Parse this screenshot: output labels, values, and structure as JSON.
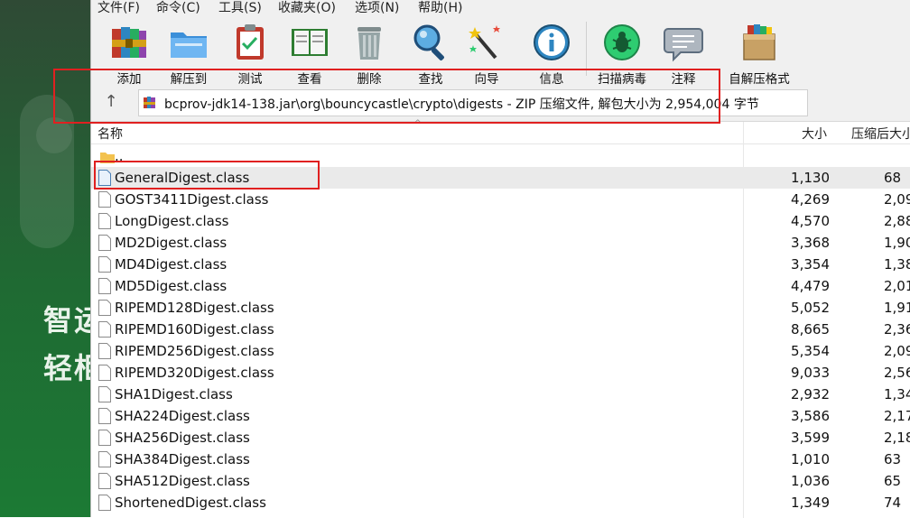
{
  "background_app": {
    "line1": "智运",
    "line2": "轻柜"
  },
  "menu": [
    {
      "label": "文件(F)"
    },
    {
      "label": "命令(C)"
    },
    {
      "label": "工具(S)"
    },
    {
      "label": "收藏夹(O)"
    },
    {
      "label": "选项(N)"
    },
    {
      "label": "帮助(H)"
    }
  ],
  "toolbar": [
    {
      "label": "添加",
      "icon": "add-books-icon"
    },
    {
      "label": "解压到",
      "icon": "extract-folder-icon"
    },
    {
      "label": "测试",
      "icon": "test-clipboard-icon"
    },
    {
      "label": "查看",
      "icon": "view-book-icon"
    },
    {
      "label": "删除",
      "icon": "trash-icon"
    },
    {
      "label": "查找",
      "icon": "magnifier-icon"
    },
    {
      "label": "向导",
      "icon": "wizard-wand-icon"
    },
    {
      "label": "信息",
      "icon": "info-icon"
    },
    {
      "label": "扫描病毒",
      "icon": "virus-scan-icon"
    },
    {
      "label": "注释",
      "icon": "comment-icon"
    },
    {
      "label": "自解压格式",
      "icon": "sfx-box-icon"
    }
  ],
  "address": {
    "up_glyph": "↑",
    "path": "bcprov-jdk14-138.jar\\org\\bouncycastle\\crypto\\digests - ZIP 压缩文件, 解包大小为 2,954,004 字节"
  },
  "columns": {
    "name": "名称",
    "size": "大小",
    "packed": "压缩后大小"
  },
  "parent_entry": "..",
  "files": [
    {
      "name": "GeneralDigest.class",
      "size": "1,130",
      "packed": "68"
    },
    {
      "name": "GOST3411Digest.class",
      "size": "4,269",
      "packed": "2,09"
    },
    {
      "name": "LongDigest.class",
      "size": "4,570",
      "packed": "2,88"
    },
    {
      "name": "MD2Digest.class",
      "size": "3,368",
      "packed": "1,90"
    },
    {
      "name": "MD4Digest.class",
      "size": "3,354",
      "packed": "1,38"
    },
    {
      "name": "MD5Digest.class",
      "size": "4,479",
      "packed": "2,01"
    },
    {
      "name": "RIPEMD128Digest.class",
      "size": "5,052",
      "packed": "1,91"
    },
    {
      "name": "RIPEMD160Digest.class",
      "size": "8,665",
      "packed": "2,36"
    },
    {
      "name": "RIPEMD256Digest.class",
      "size": "5,354",
      "packed": "2,09"
    },
    {
      "name": "RIPEMD320Digest.class",
      "size": "9,033",
      "packed": "2,56"
    },
    {
      "name": "SHA1Digest.class",
      "size": "2,932",
      "packed": "1,34"
    },
    {
      "name": "SHA224Digest.class",
      "size": "3,586",
      "packed": "2,17"
    },
    {
      "name": "SHA256Digest.class",
      "size": "3,599",
      "packed": "2,18"
    },
    {
      "name": "SHA384Digest.class",
      "size": "1,010",
      "packed": "63"
    },
    {
      "name": "SHA512Digest.class",
      "size": "1,036",
      "packed": "65"
    },
    {
      "name": "ShortenedDigest.class",
      "size": "1,349",
      "packed": "74"
    }
  ],
  "colors": {
    "highlight": "#e02020",
    "bg_app": "#1f6a33"
  }
}
